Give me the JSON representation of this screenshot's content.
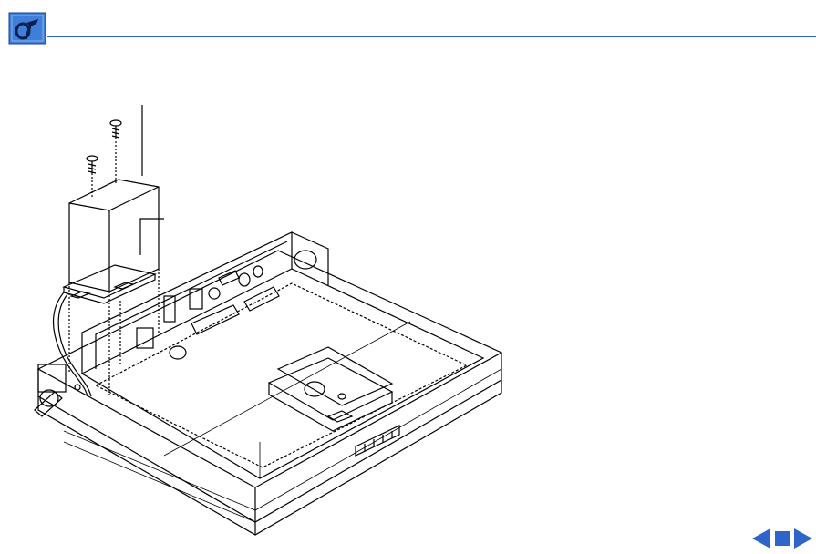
{
  "header": {
    "logo_icon": "toolbox-logo-icon",
    "rule_color": "#2f64c8",
    "logo_color": "#3f7fd9"
  },
  "illustration": {
    "icon": "powerbook-bottom-case-exploded-diagram"
  },
  "navigation": {
    "previous_icon": "left-arrow-icon",
    "stop_icon": "square-stop-icon",
    "next_icon": "right-arrow-icon",
    "color": "#2f64c8"
  }
}
